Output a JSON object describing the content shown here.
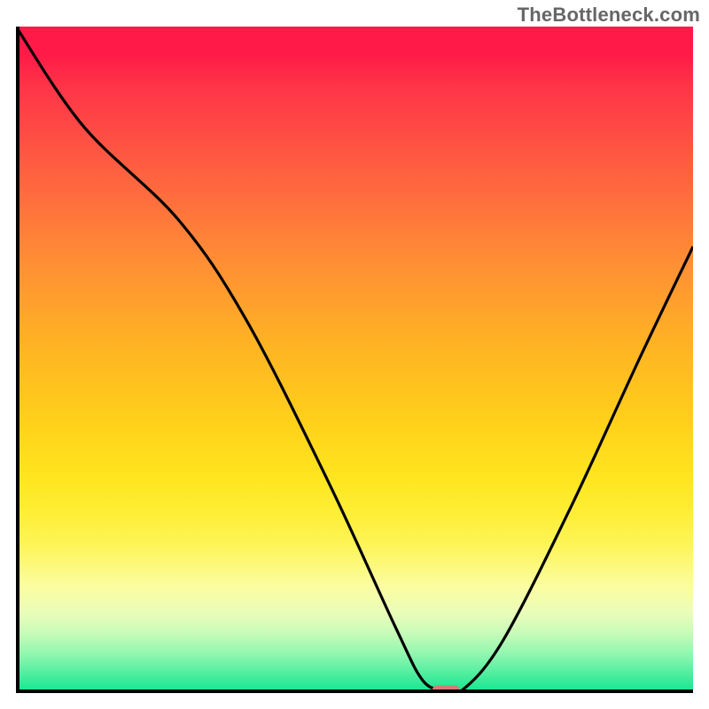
{
  "watermark": "TheBottleneck.com",
  "chart_data": {
    "type": "line",
    "title": "",
    "xlabel": "",
    "ylabel": "",
    "xlim": [
      0,
      100
    ],
    "ylim": [
      0,
      100
    ],
    "grid": false,
    "series": [
      {
        "name": "bottleneck-curve",
        "x": [
          0,
          10,
          24,
          34,
          46,
          56,
          60,
          63,
          66,
          72,
          82,
          92,
          100
        ],
        "values": [
          100,
          85,
          71,
          56,
          32,
          10,
          2,
          0.5,
          0.5,
          8,
          28,
          50,
          67
        ]
      }
    ],
    "marker": {
      "name": "optimal-point",
      "x": 63.5,
      "y": 0.5,
      "width": 4,
      "height": 1.3
    },
    "background_gradient": {
      "top_color": "#ff1a47",
      "bottom_color": "#0ee68f"
    }
  }
}
